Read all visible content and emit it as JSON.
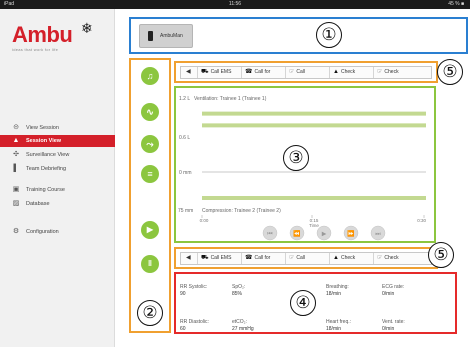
{
  "status_bar": {
    "carrier": "iPad",
    "time": "11:56",
    "battery": "45 % ■"
  },
  "brand": {
    "name": "Ambu",
    "tagline": "ideas that work for life",
    "logo_icon": "snowflake-star"
  },
  "sidebar": {
    "items": [
      {
        "label": "View Session",
        "icon": "play-circle-icon",
        "glyph": "⊝",
        "active": false
      },
      {
        "label": "Session View",
        "icon": "person-icon",
        "glyph": "▲",
        "active": true
      },
      {
        "label": "Surveillance View",
        "icon": "group-icon",
        "glyph": "✣",
        "active": false
      },
      {
        "label": "Team Debriefing",
        "icon": "notebook-icon",
        "glyph": "▌",
        "active": false
      },
      {
        "label": "Training Course",
        "icon": "course-icon",
        "glyph": "▣",
        "active": false
      },
      {
        "label": "Database",
        "icon": "database-icon",
        "glyph": "▨",
        "active": false
      },
      {
        "label": "Configuration",
        "icon": "gear-icon",
        "glyph": "⚙",
        "active": false
      }
    ]
  },
  "device": {
    "label": "AmbuMan",
    "icon": "phone-icon"
  },
  "controls": {
    "buttons": [
      {
        "name": "music-button",
        "glyph": "♫"
      },
      {
        "name": "heartbeat-button",
        "glyph": "∿"
      },
      {
        "name": "shuffle-button",
        "glyph": "⤳"
      },
      {
        "name": "list-button",
        "glyph": "≡"
      }
    ],
    "play_glyph": "▶",
    "pause_glyph": "‖"
  },
  "action_bar": {
    "back_glyph": "◀",
    "actions": [
      {
        "label": "Call EMS",
        "glyph": "⛟"
      },
      {
        "label": "Call for",
        "glyph": "☎"
      },
      {
        "label": "Call",
        "glyph": "☞"
      },
      {
        "label": "Check",
        "glyph": "▲"
      },
      {
        "label": "Check",
        "glyph": "☞"
      }
    ]
  },
  "chart_data": {
    "type": "line",
    "ventilation": {
      "title": "Ventilation: Trainee 1 (Trainee 1)",
      "y_ticks": [
        "1.2 L",
        "0.6 L",
        "0 mm"
      ],
      "target_band_lines": [
        1.0,
        0.8
      ],
      "baseline": 0
    },
    "compression": {
      "title": "Compression: Trainee 2 (Trainee 2)",
      "y_tick": "75 mm",
      "band_line": 60
    },
    "x_ticks": [
      "0:00",
      "0:15",
      "0:30"
    ],
    "x_label": "Time",
    "xlim_seconds": [
      0,
      30
    ],
    "playback": [
      "⏮",
      "⏪",
      "▶",
      "⏩",
      "⏭"
    ]
  },
  "vitals": [
    {
      "label": "RR Systolic:",
      "value": "90"
    },
    {
      "label": "SpO₂:",
      "value": "85%"
    },
    {
      "label": "Breathing:",
      "value": "18/min"
    },
    {
      "label": "ECG rate:",
      "value": "0/min"
    },
    {
      "label": "RR Diastolic:",
      "value": "60"
    },
    {
      "label": "etCO₂:",
      "value": "27 mmHg"
    },
    {
      "label": "Heart freq.:",
      "value": "18/min"
    },
    {
      "label": "Vent. rate:",
      "value": "0/min"
    }
  ],
  "annotations": [
    "①",
    "②",
    "③",
    "④",
    "⑤",
    "⑤"
  ]
}
